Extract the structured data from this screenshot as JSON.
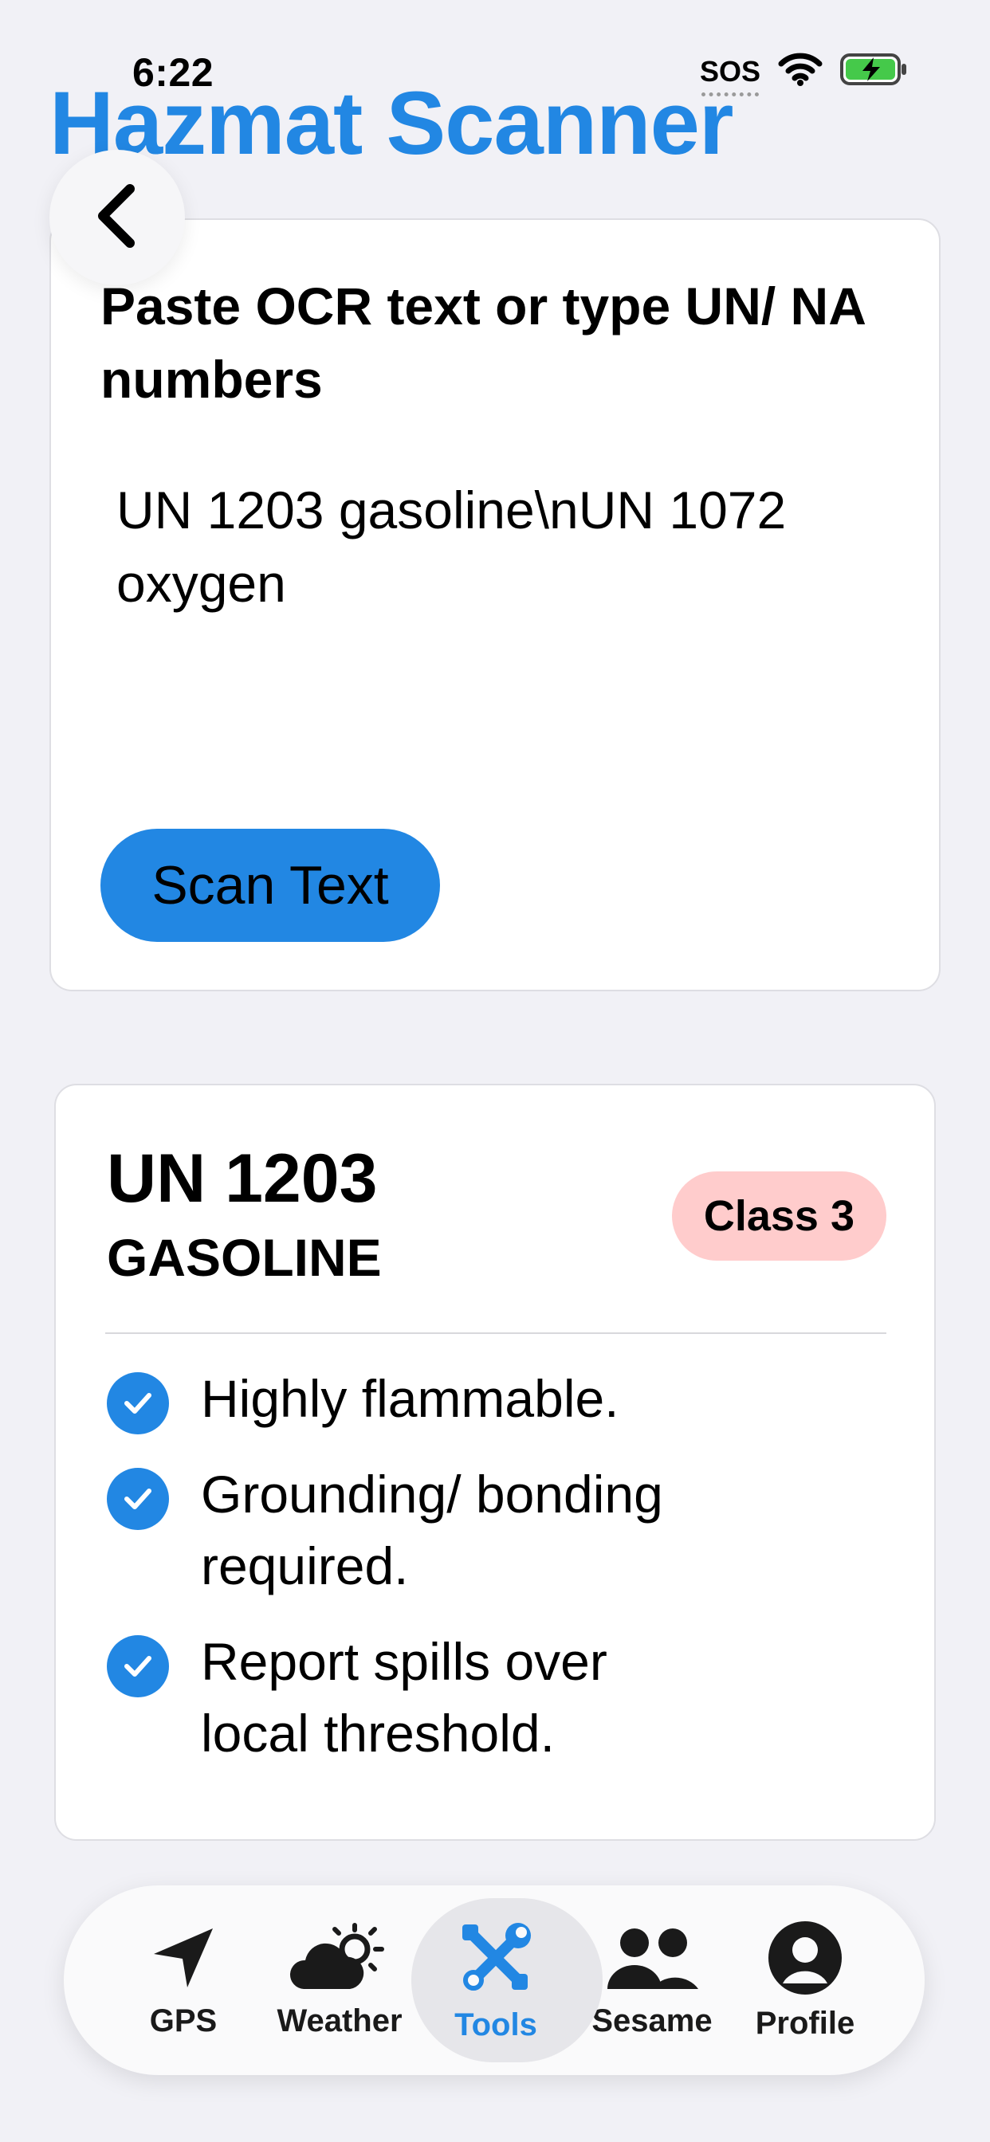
{
  "status_bar": {
    "time": "6:22",
    "sos": "SOS"
  },
  "header": {
    "title": "Hazmat Scanner"
  },
  "input_card": {
    "prompt": "Paste OCR text or type UN/ NA numbers",
    "text_value": "UN 1203 gasoline\\nUN 1072 oxygen",
    "scan_button": "Scan Text"
  },
  "result_card": {
    "un_number": "UN 1203",
    "name": "GASOLINE",
    "class_badge": "Class 3",
    "notes": [
      "Highly flammable.",
      "Grounding/ bonding required.",
      "Report spills over local threshold."
    ]
  },
  "tabs": [
    {
      "label": "GPS",
      "icon": "location-arrow-icon"
    },
    {
      "label": "Weather",
      "icon": "cloud-sun-icon"
    },
    {
      "label": "Tools",
      "icon": "wrench-screwdriver-icon",
      "active": true
    },
    {
      "label": "Sesame",
      "icon": "people-icon"
    },
    {
      "label": "Profile",
      "icon": "person-circle-icon"
    }
  ],
  "colors": {
    "accent": "#2287e3",
    "badge_bg": "#ffcccc",
    "background": "#f1f1f6"
  }
}
